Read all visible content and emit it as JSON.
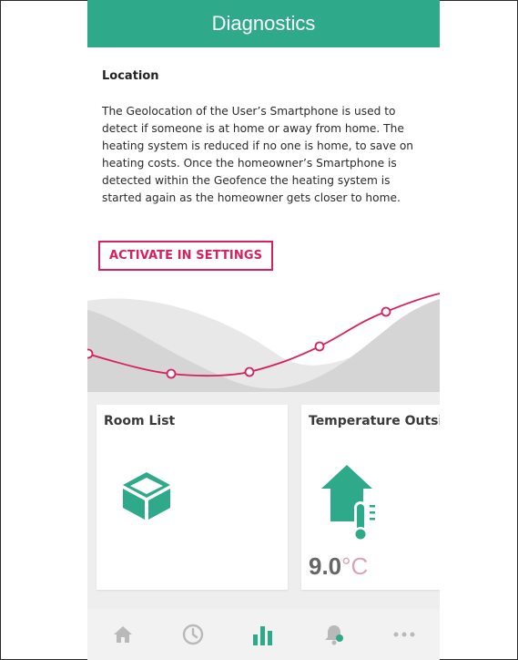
{
  "header": {
    "title": "Diagnostics"
  },
  "location": {
    "heading": "Location",
    "description": "The Geolocation of the User’s Smartphone is used to detect if someone is at home or away from home. The heating system is reduced if no one is home, to save on heating costs. Once the homeowner’s Smartphone is detected within the Geofence the heating system is started again as the homeowner gets closer to home.",
    "action_label": "ACTIVATE IN SETTINGS"
  },
  "cards": {
    "room_list": {
      "title": "Room List",
      "icon": "room-list-icon"
    },
    "temperature": {
      "title": "Temperature Outside",
      "value": "9.0",
      "unit": "°C",
      "icon": "house-thermometer-icon"
    }
  },
  "tabbar": {
    "items": [
      {
        "icon": "home-icon"
      },
      {
        "icon": "clock-icon"
      },
      {
        "icon": "bar-chart-icon"
      },
      {
        "icon": "bell-icon"
      },
      {
        "icon": "more-icon"
      }
    ]
  },
  "colors": {
    "accent": "#2ea98a",
    "brand_pink": "#d62060",
    "inactive_icon": "#b9b9b9"
  }
}
